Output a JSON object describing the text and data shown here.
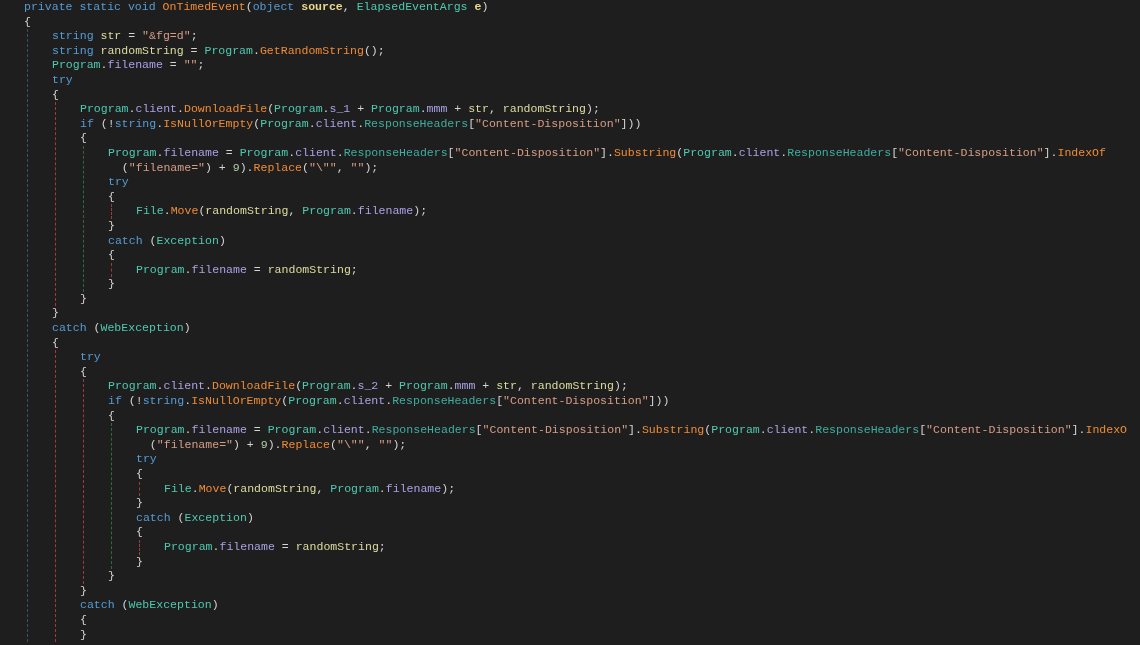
{
  "code": [
    {
      "tokens": [
        {
          "kind": "keyword",
          "text": "private static void "
        },
        {
          "kind": "method",
          "text": "OnTimedEvent"
        },
        {
          "kind": "plain",
          "text": "("
        },
        {
          "kind": "keyword",
          "text": "object "
        },
        {
          "kind": "param",
          "text": "source"
        },
        {
          "kind": "plain",
          "text": ", "
        },
        {
          "kind": "type",
          "text": "ElapsedEventArgs "
        },
        {
          "kind": "param",
          "text": "e"
        },
        {
          "kind": "plain",
          "text": ")"
        }
      ]
    },
    {
      "tokens": [
        {
          "kind": "plain",
          "text": "{"
        }
      ],
      "color": "#2c5566",
      "children": [
        {
          "tokens": [
            {
              "kind": "keyword",
              "text": "string "
            },
            {
              "kind": "local",
              "text": "str"
            },
            {
              "kind": "plain",
              "text": " = "
            },
            {
              "kind": "string",
              "text": "\"&fg=d\""
            },
            {
              "kind": "plain",
              "text": ";"
            }
          ]
        },
        {
          "tokens": [
            {
              "kind": "keyword",
              "text": "string "
            },
            {
              "kind": "local",
              "text": "randomString"
            },
            {
              "kind": "plain",
              "text": " = "
            },
            {
              "kind": "type",
              "text": "Program"
            },
            {
              "kind": "plain",
              "text": "."
            },
            {
              "kind": "method",
              "text": "GetRandomString"
            },
            {
              "kind": "plain",
              "text": "();"
            }
          ]
        },
        {
          "tokens": [
            {
              "kind": "type",
              "text": "Program"
            },
            {
              "kind": "plain",
              "text": "."
            },
            {
              "kind": "field",
              "text": "filename"
            },
            {
              "kind": "plain",
              "text": " = "
            },
            {
              "kind": "string",
              "text": "\"\""
            },
            {
              "kind": "plain",
              "text": ";"
            }
          ]
        },
        {
          "tokens": [
            {
              "kind": "keyword",
              "text": "try"
            }
          ]
        },
        {
          "tokens": [
            {
              "kind": "plain",
              "text": "{"
            }
          ],
          "color": "#a33a3a",
          "children": [
            {
              "tokens": [
                {
                  "kind": "type",
                  "text": "Program"
                },
                {
                  "kind": "plain",
                  "text": "."
                },
                {
                  "kind": "field",
                  "text": "client"
                },
                {
                  "kind": "plain",
                  "text": "."
                },
                {
                  "kind": "method",
                  "text": "DownloadFile"
                },
                {
                  "kind": "plain",
                  "text": "("
                },
                {
                  "kind": "type",
                  "text": "Program"
                },
                {
                  "kind": "plain",
                  "text": "."
                },
                {
                  "kind": "field",
                  "text": "s_1"
                },
                {
                  "kind": "plain",
                  "text": " + "
                },
                {
                  "kind": "type",
                  "text": "Program"
                },
                {
                  "kind": "plain",
                  "text": "."
                },
                {
                  "kind": "field",
                  "text": "mmm"
                },
                {
                  "kind": "plain",
                  "text": " + "
                },
                {
                  "kind": "local",
                  "text": "str"
                },
                {
                  "kind": "plain",
                  "text": ", "
                },
                {
                  "kind": "local",
                  "text": "randomString"
                },
                {
                  "kind": "plain",
                  "text": ");"
                }
              ]
            },
            {
              "tokens": [
                {
                  "kind": "keyword",
                  "text": "if"
                },
                {
                  "kind": "plain",
                  "text": " (!"
                },
                {
                  "kind": "keyword",
                  "text": "string"
                },
                {
                  "kind": "plain",
                  "text": "."
                },
                {
                  "kind": "method",
                  "text": "IsNullOrEmpty"
                },
                {
                  "kind": "plain",
                  "text": "("
                },
                {
                  "kind": "type",
                  "text": "Program"
                },
                {
                  "kind": "plain",
                  "text": "."
                },
                {
                  "kind": "field",
                  "text": "client"
                },
                {
                  "kind": "plain",
                  "text": "."
                },
                {
                  "kind": "property",
                  "text": "ResponseHeaders"
                },
                {
                  "kind": "plain",
                  "text": "["
                },
                {
                  "kind": "string",
                  "text": "\"Content-Disposition\""
                },
                {
                  "kind": "plain",
                  "text": "]))"
                }
              ]
            },
            {
              "tokens": [
                {
                  "kind": "plain",
                  "text": "{"
                }
              ],
              "color": "#2f6b3f",
              "children": [
                {
                  "tokens": [
                    {
                      "kind": "type",
                      "text": "Program"
                    },
                    {
                      "kind": "plain",
                      "text": "."
                    },
                    {
                      "kind": "field",
                      "text": "filename"
                    },
                    {
                      "kind": "plain",
                      "text": " = "
                    },
                    {
                      "kind": "type",
                      "text": "Program"
                    },
                    {
                      "kind": "plain",
                      "text": "."
                    },
                    {
                      "kind": "field",
                      "text": "client"
                    },
                    {
                      "kind": "plain",
                      "text": "."
                    },
                    {
                      "kind": "property",
                      "text": "ResponseHeaders"
                    },
                    {
                      "kind": "plain",
                      "text": "["
                    },
                    {
                      "kind": "string",
                      "text": "\"Content-Disposition\""
                    },
                    {
                      "kind": "plain",
                      "text": "]."
                    },
                    {
                      "kind": "method",
                      "text": "Substring"
                    },
                    {
                      "kind": "plain",
                      "text": "("
                    },
                    {
                      "kind": "type",
                      "text": "Program"
                    },
                    {
                      "kind": "plain",
                      "text": "."
                    },
                    {
                      "kind": "field",
                      "text": "client"
                    },
                    {
                      "kind": "plain",
                      "text": "."
                    },
                    {
                      "kind": "property",
                      "text": "ResponseHeaders"
                    },
                    {
                      "kind": "plain",
                      "text": "["
                    },
                    {
                      "kind": "string",
                      "text": "\"Content-Disposition\""
                    },
                    {
                      "kind": "plain",
                      "text": "]."
                    },
                    {
                      "kind": "method",
                      "text": "IndexOf"
                    }
                  ]
                },
                {
                  "kind": "continuation",
                  "tokens": [
                    {
                      "kind": "plain",
                      "text": "("
                    },
                    {
                      "kind": "string",
                      "text": "\"filename=\""
                    },
                    {
                      "kind": "plain",
                      "text": ") + "
                    },
                    {
                      "kind": "number",
                      "text": "9"
                    },
                    {
                      "kind": "plain",
                      "text": ")."
                    },
                    {
                      "kind": "method",
                      "text": "Replace"
                    },
                    {
                      "kind": "plain",
                      "text": "("
                    },
                    {
                      "kind": "string",
                      "text": "\"\\\"\""
                    },
                    {
                      "kind": "plain",
                      "text": ", "
                    },
                    {
                      "kind": "string",
                      "text": "\"\""
                    },
                    {
                      "kind": "plain",
                      "text": ");"
                    }
                  ]
                },
                {
                  "tokens": [
                    {
                      "kind": "keyword",
                      "text": "try"
                    }
                  ]
                },
                {
                  "tokens": [
                    {
                      "kind": "plain",
                      "text": "{"
                    }
                  ],
                  "color": "#a33a3a",
                  "children": [
                    {
                      "tokens": [
                        {
                          "kind": "type",
                          "text": "File"
                        },
                        {
                          "kind": "plain",
                          "text": "."
                        },
                        {
                          "kind": "method",
                          "text": "Move"
                        },
                        {
                          "kind": "plain",
                          "text": "("
                        },
                        {
                          "kind": "local",
                          "text": "randomString"
                        },
                        {
                          "kind": "plain",
                          "text": ", "
                        },
                        {
                          "kind": "type",
                          "text": "Program"
                        },
                        {
                          "kind": "plain",
                          "text": "."
                        },
                        {
                          "kind": "field",
                          "text": "filename"
                        },
                        {
                          "kind": "plain",
                          "text": ");"
                        }
                      ]
                    }
                  ]
                },
                {
                  "tokens": [
                    {
                      "kind": "plain",
                      "text": "}"
                    }
                  ]
                },
                {
                  "tokens": [
                    {
                      "kind": "keyword",
                      "text": "catch"
                    },
                    {
                      "kind": "plain",
                      "text": " ("
                    },
                    {
                      "kind": "type",
                      "text": "Exception"
                    },
                    {
                      "kind": "plain",
                      "text": ")"
                    }
                  ]
                },
                {
                  "tokens": [
                    {
                      "kind": "plain",
                      "text": "{"
                    }
                  ],
                  "color": "#a33a3a",
                  "children": [
                    {
                      "tokens": [
                        {
                          "kind": "type",
                          "text": "Program"
                        },
                        {
                          "kind": "plain",
                          "text": "."
                        },
                        {
                          "kind": "field",
                          "text": "filename"
                        },
                        {
                          "kind": "plain",
                          "text": " = "
                        },
                        {
                          "kind": "local",
                          "text": "randomString"
                        },
                        {
                          "kind": "plain",
                          "text": ";"
                        }
                      ]
                    }
                  ]
                },
                {
                  "tokens": [
                    {
                      "kind": "plain",
                      "text": "}"
                    }
                  ]
                }
              ]
            },
            {
              "tokens": [
                {
                  "kind": "plain",
                  "text": "}"
                }
              ]
            }
          ]
        },
        {
          "tokens": [
            {
              "kind": "plain",
              "text": "}"
            }
          ]
        },
        {
          "tokens": [
            {
              "kind": "keyword",
              "text": "catch"
            },
            {
              "kind": "plain",
              "text": " ("
            },
            {
              "kind": "type",
              "text": "WebException"
            },
            {
              "kind": "plain",
              "text": ")"
            }
          ]
        },
        {
          "tokens": [
            {
              "kind": "plain",
              "text": "{"
            }
          ],
          "color": "#a33a3a",
          "children": [
            {
              "tokens": [
                {
                  "kind": "keyword",
                  "text": "try"
                }
              ]
            },
            {
              "tokens": [
                {
                  "kind": "plain",
                  "text": "{"
                }
              ],
              "color": "#a33a3a",
              "children": [
                {
                  "tokens": [
                    {
                      "kind": "type",
                      "text": "Program"
                    },
                    {
                      "kind": "plain",
                      "text": "."
                    },
                    {
                      "kind": "field",
                      "text": "client"
                    },
                    {
                      "kind": "plain",
                      "text": "."
                    },
                    {
                      "kind": "method",
                      "text": "DownloadFile"
                    },
                    {
                      "kind": "plain",
                      "text": "("
                    },
                    {
                      "kind": "type",
                      "text": "Program"
                    },
                    {
                      "kind": "plain",
                      "text": "."
                    },
                    {
                      "kind": "field",
                      "text": "s_2"
                    },
                    {
                      "kind": "plain",
                      "text": " + "
                    },
                    {
                      "kind": "type",
                      "text": "Program"
                    },
                    {
                      "kind": "plain",
                      "text": "."
                    },
                    {
                      "kind": "field",
                      "text": "mmm"
                    },
                    {
                      "kind": "plain",
                      "text": " + "
                    },
                    {
                      "kind": "local",
                      "text": "str"
                    },
                    {
                      "kind": "plain",
                      "text": ", "
                    },
                    {
                      "kind": "local",
                      "text": "randomString"
                    },
                    {
                      "kind": "plain",
                      "text": ");"
                    }
                  ]
                },
                {
                  "tokens": [
                    {
                      "kind": "keyword",
                      "text": "if"
                    },
                    {
                      "kind": "plain",
                      "text": " (!"
                    },
                    {
                      "kind": "keyword",
                      "text": "string"
                    },
                    {
                      "kind": "plain",
                      "text": "."
                    },
                    {
                      "kind": "method",
                      "text": "IsNullOrEmpty"
                    },
                    {
                      "kind": "plain",
                      "text": "("
                    },
                    {
                      "kind": "type",
                      "text": "Program"
                    },
                    {
                      "kind": "plain",
                      "text": "."
                    },
                    {
                      "kind": "field",
                      "text": "client"
                    },
                    {
                      "kind": "plain",
                      "text": "."
                    },
                    {
                      "kind": "property",
                      "text": "ResponseHeaders"
                    },
                    {
                      "kind": "plain",
                      "text": "["
                    },
                    {
                      "kind": "string",
                      "text": "\"Content-Disposition\""
                    },
                    {
                      "kind": "plain",
                      "text": "]))"
                    }
                  ]
                },
                {
                  "tokens": [
                    {
                      "kind": "plain",
                      "text": "{"
                    }
                  ],
                  "color": "#2f6b3f",
                  "children": [
                    {
                      "tokens": [
                        {
                          "kind": "type",
                          "text": "Program"
                        },
                        {
                          "kind": "plain",
                          "text": "."
                        },
                        {
                          "kind": "field",
                          "text": "filename"
                        },
                        {
                          "kind": "plain",
                          "text": " = "
                        },
                        {
                          "kind": "type",
                          "text": "Program"
                        },
                        {
                          "kind": "plain",
                          "text": "."
                        },
                        {
                          "kind": "field",
                          "text": "client"
                        },
                        {
                          "kind": "plain",
                          "text": "."
                        },
                        {
                          "kind": "property",
                          "text": "ResponseHeaders"
                        },
                        {
                          "kind": "plain",
                          "text": "["
                        },
                        {
                          "kind": "string",
                          "text": "\"Content-Disposition\""
                        },
                        {
                          "kind": "plain",
                          "text": "]."
                        },
                        {
                          "kind": "method",
                          "text": "Substring"
                        },
                        {
                          "kind": "plain",
                          "text": "("
                        },
                        {
                          "kind": "type",
                          "text": "Program"
                        },
                        {
                          "kind": "plain",
                          "text": "."
                        },
                        {
                          "kind": "field",
                          "text": "client"
                        },
                        {
                          "kind": "plain",
                          "text": "."
                        },
                        {
                          "kind": "property",
                          "text": "ResponseHeaders"
                        },
                        {
                          "kind": "plain",
                          "text": "["
                        },
                        {
                          "kind": "string",
                          "text": "\"Content-Disposition\""
                        },
                        {
                          "kind": "plain",
                          "text": "]."
                        },
                        {
                          "kind": "method",
                          "text": "IndexO"
                        }
                      ]
                    },
                    {
                      "kind": "continuation",
                      "tokens": [
                        {
                          "kind": "plain",
                          "text": "("
                        },
                        {
                          "kind": "string",
                          "text": "\"filename=\""
                        },
                        {
                          "kind": "plain",
                          "text": ") + "
                        },
                        {
                          "kind": "number",
                          "text": "9"
                        },
                        {
                          "kind": "plain",
                          "text": ")."
                        },
                        {
                          "kind": "method",
                          "text": "Replace"
                        },
                        {
                          "kind": "plain",
                          "text": "("
                        },
                        {
                          "kind": "string",
                          "text": "\"\\\"\""
                        },
                        {
                          "kind": "plain",
                          "text": ", "
                        },
                        {
                          "kind": "string",
                          "text": "\"\""
                        },
                        {
                          "kind": "plain",
                          "text": ");"
                        }
                      ]
                    },
                    {
                      "tokens": [
                        {
                          "kind": "keyword",
                          "text": "try"
                        }
                      ]
                    },
                    {
                      "tokens": [
                        {
                          "kind": "plain",
                          "text": "{"
                        }
                      ],
                      "color": "#a33a3a",
                      "children": [
                        {
                          "tokens": [
                            {
                              "kind": "type",
                              "text": "File"
                            },
                            {
                              "kind": "plain",
                              "text": "."
                            },
                            {
                              "kind": "method",
                              "text": "Move"
                            },
                            {
                              "kind": "plain",
                              "text": "("
                            },
                            {
                              "kind": "local",
                              "text": "randomString"
                            },
                            {
                              "kind": "plain",
                              "text": ", "
                            },
                            {
                              "kind": "type",
                              "text": "Program"
                            },
                            {
                              "kind": "plain",
                              "text": "."
                            },
                            {
                              "kind": "field",
                              "text": "filename"
                            },
                            {
                              "kind": "plain",
                              "text": ");"
                            }
                          ]
                        }
                      ]
                    },
                    {
                      "tokens": [
                        {
                          "kind": "plain",
                          "text": "}"
                        }
                      ]
                    },
                    {
                      "tokens": [
                        {
                          "kind": "keyword",
                          "text": "catch"
                        },
                        {
                          "kind": "plain",
                          "text": " ("
                        },
                        {
                          "kind": "type",
                          "text": "Exception"
                        },
                        {
                          "kind": "plain",
                          "text": ")"
                        }
                      ]
                    },
                    {
                      "tokens": [
                        {
                          "kind": "plain",
                          "text": "{"
                        }
                      ],
                      "color": "#a33a3a",
                      "children": [
                        {
                          "tokens": [
                            {
                              "kind": "type",
                              "text": "Program"
                            },
                            {
                              "kind": "plain",
                              "text": "."
                            },
                            {
                              "kind": "field",
                              "text": "filename"
                            },
                            {
                              "kind": "plain",
                              "text": " = "
                            },
                            {
                              "kind": "local",
                              "text": "randomString"
                            },
                            {
                              "kind": "plain",
                              "text": ";"
                            }
                          ]
                        }
                      ]
                    },
                    {
                      "tokens": [
                        {
                          "kind": "plain",
                          "text": "}"
                        }
                      ]
                    }
                  ]
                },
                {
                  "tokens": [
                    {
                      "kind": "plain",
                      "text": "}"
                    }
                  ]
                }
              ]
            },
            {
              "tokens": [
                {
                  "kind": "plain",
                  "text": "}"
                }
              ]
            },
            {
              "tokens": [
                {
                  "kind": "keyword",
                  "text": "catch"
                },
                {
                  "kind": "plain",
                  "text": " ("
                },
                {
                  "kind": "type",
                  "text": "WebException"
                },
                {
                  "kind": "plain",
                  "text": ")"
                }
              ]
            },
            {
              "tokens": [
                {
                  "kind": "plain",
                  "text": "{"
                }
              ]
            },
            {
              "tokens": [
                {
                  "kind": "plain",
                  "text": "}"
                }
              ]
            }
          ]
        }
      ]
    }
  ]
}
